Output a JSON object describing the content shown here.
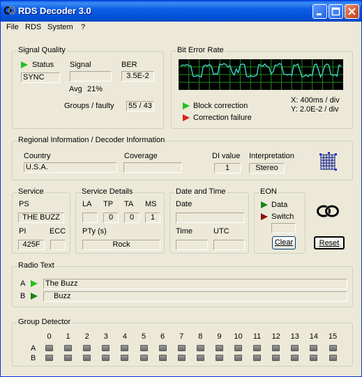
{
  "window": {
    "title": "RDS Decoder 3.0"
  },
  "menu": [
    "File",
    "RDS",
    "System",
    "?"
  ],
  "signal_quality": {
    "title": "Signal Quality",
    "status_label": "Status",
    "status_value": "SYNC",
    "signal_label": "Signal",
    "signal_value": "",
    "avg_label": "Avg",
    "avg_value": "21%",
    "ber_label": "BER",
    "ber_value": "3.5E-2",
    "groups_label": "Groups / faulty",
    "groups_value": "55 / 43"
  },
  "ber_panel": {
    "title": "Bit Error Rate",
    "block_correction": "Block correction",
    "correction_failure": "Correction failure",
    "x_scale": "X: 400ms / div",
    "y_scale": "Y: 2.0E-2 / div",
    "trace_color": "#3FD4C4",
    "grid_color": "#1E8C1E",
    "plot_background": "#000000",
    "trace": [
      0.42,
      0.44,
      0.43,
      0.45,
      0.43,
      0.42,
      0.22,
      0.21,
      0.23,
      0.22,
      0.2,
      0.41,
      0.44,
      0.42,
      0.45,
      0.41,
      0.25,
      0.27,
      0.26,
      0.46,
      0.44,
      0.47,
      0.45,
      0.4,
      0.43,
      0.3,
      0.24,
      0.36,
      0.29,
      0.44,
      0.46,
      0.45,
      0.22,
      0.2,
      0.23,
      0.21,
      0.22,
      0.24,
      0.45,
      0.43,
      0.42,
      0.46,
      0.41,
      0.39,
      0.26,
      0.31,
      0.44,
      0.43,
      0.47,
      0.45,
      0.27,
      0.25,
      0.24,
      0.26,
      0.23,
      0.44,
      0.43,
      0.46,
      0.33,
      0.2,
      0.22,
      0.24,
      0.21,
      0.25,
      0.23,
      0.44,
      0.46,
      0.34,
      0.2,
      0.28,
      0.42,
      0.46,
      0.44,
      0.26,
      0.23,
      0.25,
      0.22,
      0.44,
      0.42
    ]
  },
  "regional": {
    "title": "Regional Information / Decoder Information",
    "country_label": "Country",
    "country_value": "U.S.A.",
    "coverage_label": "Coverage",
    "coverage_value": "",
    "di_label": "DI value",
    "di_value": "1",
    "interpretation_label": "Interpretation",
    "interpretation_value": "Stereo"
  },
  "service": {
    "title": "Service",
    "ps_label": "PS",
    "ps_value": "THE BUZZ",
    "pi_label": "PI",
    "pi_value": "425F",
    "ecc_label": "ECC",
    "ecc_value": ""
  },
  "service_details": {
    "title": "Service Details",
    "la_label": "LA",
    "la_value": "",
    "tp_label": "TP",
    "tp_value": "0",
    "ta_label": "TA",
    "ta_value": "0",
    "ms_label": "MS",
    "ms_value": "1",
    "pty_label": "PTy (s)",
    "pty_value": "Rock"
  },
  "date_time": {
    "title": "Date and Time",
    "date_label": "Date",
    "date_value": "",
    "time_label": "Time",
    "time_value": "",
    "utc_label": "UTC",
    "utc_value": ""
  },
  "eon": {
    "title": "EON",
    "data_label": "Data",
    "switch_label": "Switch",
    "switch_value": "",
    "clear_label": "Clear"
  },
  "reset_label": "Reset",
  "radio_text": {
    "title": "Radio Text",
    "a_label": "A",
    "a_value": "The Buzz",
    "b_label": "B",
    "b_value": "Buzz"
  },
  "group_detector": {
    "title": "Group Detector",
    "columns": [
      "0",
      "1",
      "2",
      "3",
      "4",
      "5",
      "6",
      "7",
      "8",
      "9",
      "10",
      "11",
      "12",
      "13",
      "14",
      "15"
    ],
    "rows": [
      "A",
      "B"
    ]
  }
}
